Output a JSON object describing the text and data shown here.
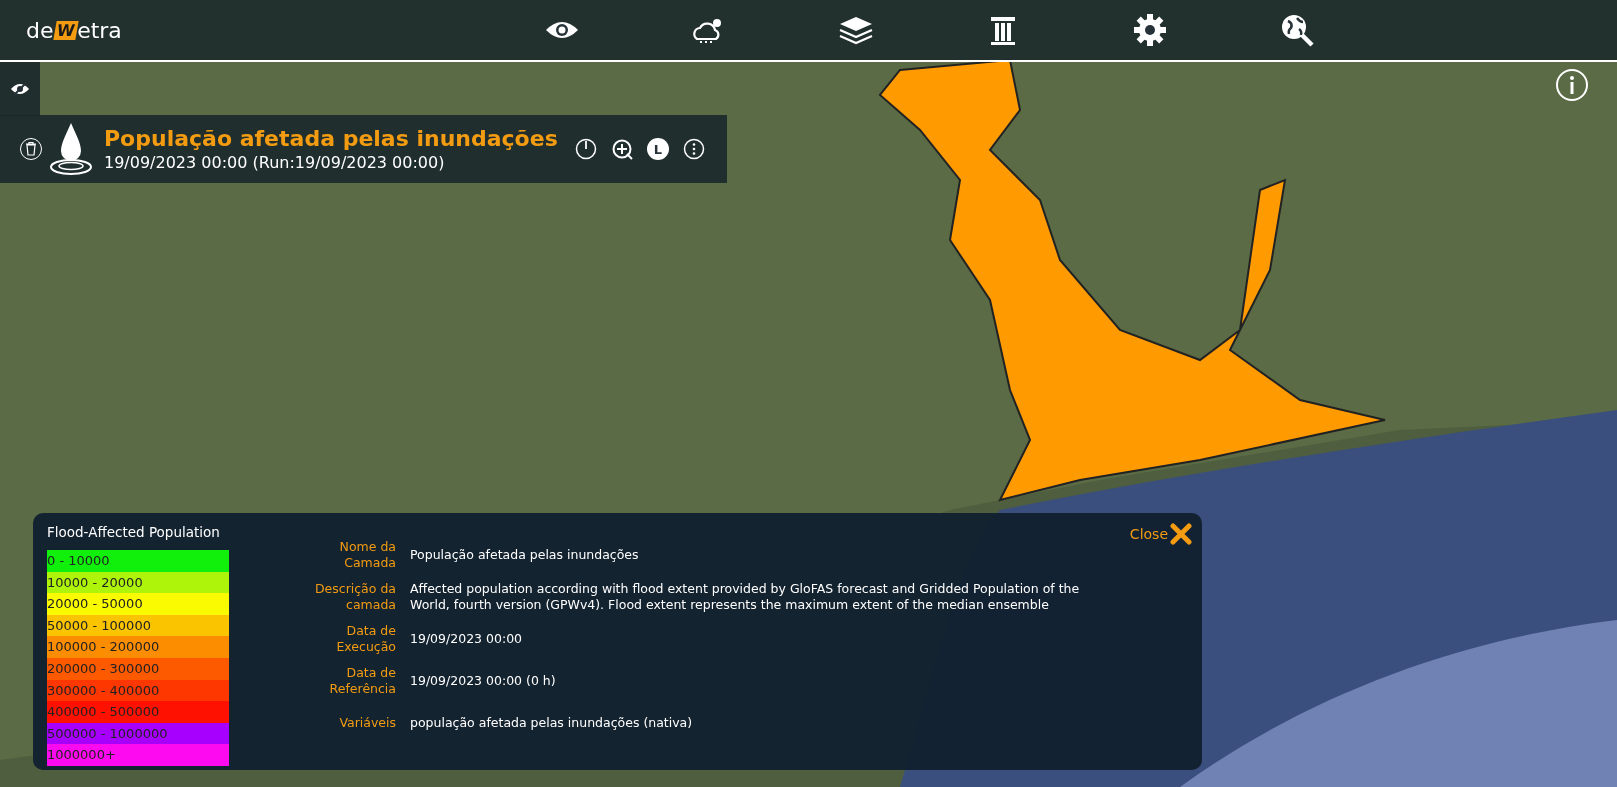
{
  "logo": {
    "before": "de",
    "mark": "W",
    "after": "etra"
  },
  "toolbar": [
    {
      "kind": "eye"
    },
    {
      "kind": "weather"
    },
    {
      "kind": "layers"
    },
    {
      "kind": "column"
    },
    {
      "kind": "gear"
    },
    {
      "kind": "globe-search"
    }
  ],
  "layer": {
    "title": "População afetada pelas inundações",
    "subtitle": "19/09/2023 00:00 (Run:19/09/2023 00:00)",
    "controls": [
      {
        "kind": "power"
      },
      {
        "kind": "zoom"
      },
      {
        "kind": "letter",
        "label": "L"
      },
      {
        "kind": "more"
      }
    ]
  },
  "info_panel": {
    "legend": {
      "title": "Flood-Affected Population",
      "items": [
        {
          "label": "0 - 10000",
          "color": "#10f00a"
        },
        {
          "label": "10000 - 20000",
          "color": "#aef40a"
        },
        {
          "label": "20000 - 50000",
          "color": "#fafa00"
        },
        {
          "label": "50000 - 100000",
          "color": "#fbc400"
        },
        {
          "label": "100000 - 200000",
          "color": "#fc8d00"
        },
        {
          "label": "200000 - 300000",
          "color": "#fd5a00"
        },
        {
          "label": "300000 - 400000",
          "color": "#fe3700"
        },
        {
          "label": "400000 - 500000",
          "color": "#fe1100"
        },
        {
          "label": "500000 - 1000000",
          "color": "#a800ff"
        },
        {
          "label": "1000000+",
          "color": "#fe0af0"
        }
      ]
    },
    "close_label": "Close",
    "fields": [
      {
        "label": "Nome da Camada",
        "value": "População afetada pelas inundações"
      },
      {
        "label": "Descrição da camada",
        "value": "Affected population according with flood extent provided by GloFAS forecast and Gridded Population of the World, fourth version (GPWv4). Flood extent represents the maximum extent of the median ensemble"
      },
      {
        "label": "Data de Execução",
        "value": "19/09/2023 00:00"
      },
      {
        "label": "Data de Referência",
        "value": "19/09/2023 00:00 (0 h)"
      },
      {
        "label": "Variáveis",
        "value": "população afetada pelas inundações (nativa)"
      }
    ]
  }
}
